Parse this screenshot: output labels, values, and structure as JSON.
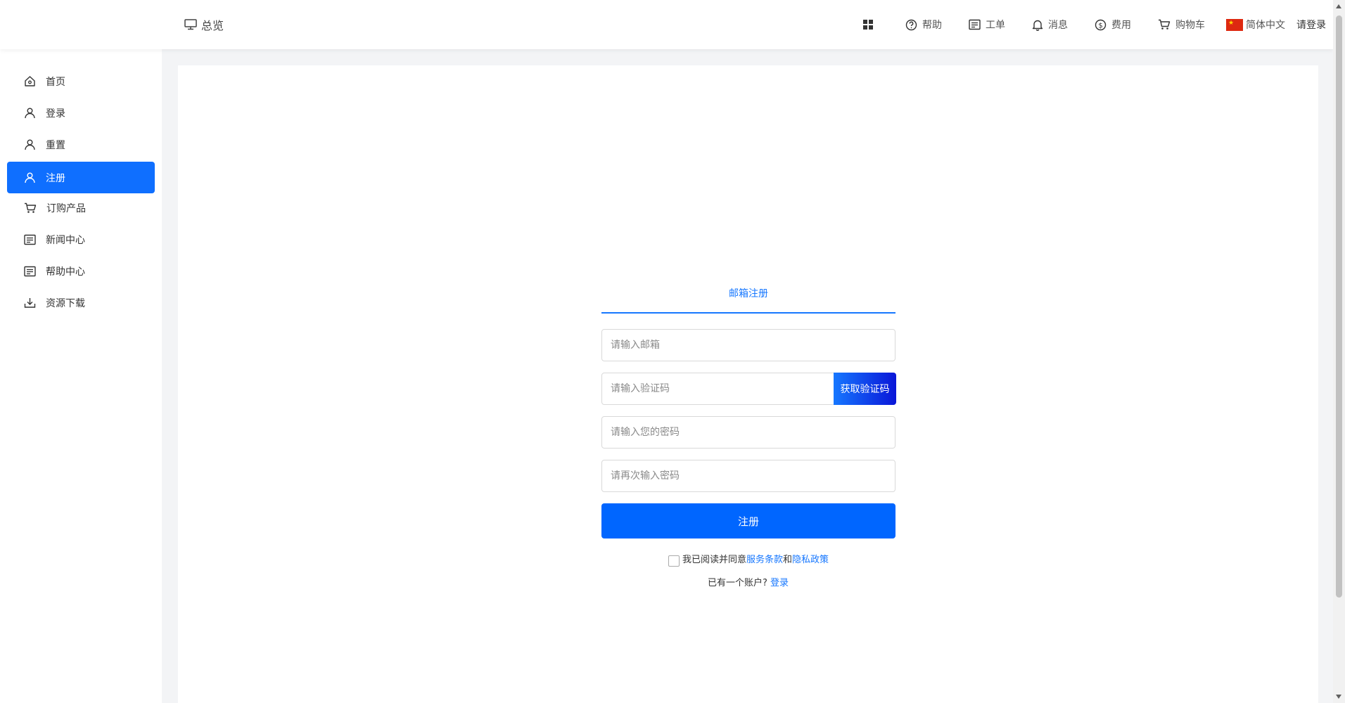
{
  "header": {
    "overview_label": "总览",
    "nav": [
      {
        "icon": "grid-icon",
        "label": ""
      },
      {
        "icon": "help-circle-icon",
        "label": "帮助"
      },
      {
        "icon": "ticket-icon",
        "label": "工单"
      },
      {
        "icon": "bell-icon",
        "label": "消息"
      },
      {
        "icon": "dollar-circle-icon",
        "label": "费用"
      },
      {
        "icon": "cart-icon",
        "label": "购物车"
      }
    ],
    "language": "简体中文",
    "login": "请登录"
  },
  "sidebar": {
    "items": [
      {
        "icon": "home-icon",
        "label": "首页",
        "active": false
      },
      {
        "icon": "user-icon",
        "label": "登录",
        "active": false
      },
      {
        "icon": "user-icon",
        "label": "重置",
        "active": false
      },
      {
        "icon": "user-icon",
        "label": "注册",
        "active": true
      },
      {
        "icon": "cart-icon",
        "label": "订购产品",
        "active": false
      },
      {
        "icon": "document-icon",
        "label": "新闻中心",
        "active": false
      },
      {
        "icon": "document-icon",
        "label": "帮助中心",
        "active": false
      },
      {
        "icon": "download-icon",
        "label": "资源下载",
        "active": false
      }
    ]
  },
  "form": {
    "tab_label": "邮箱注册",
    "email_placeholder": "请输入邮箱",
    "code_placeholder": "请输入验证码",
    "get_code_label": "获取验证码",
    "password_placeholder": "请输入您的密码",
    "confirm_placeholder": "请再次输入密码",
    "submit_label": "注册",
    "agree_prefix": "我已阅读并同意",
    "terms_link": "服务条款",
    "and_text": "和",
    "privacy_link": "隐私政策",
    "have_account_text": "已有一个账户?",
    "login_link": "登录"
  },
  "colors": {
    "accent": "#0f6fff",
    "link": "#1677ff"
  }
}
